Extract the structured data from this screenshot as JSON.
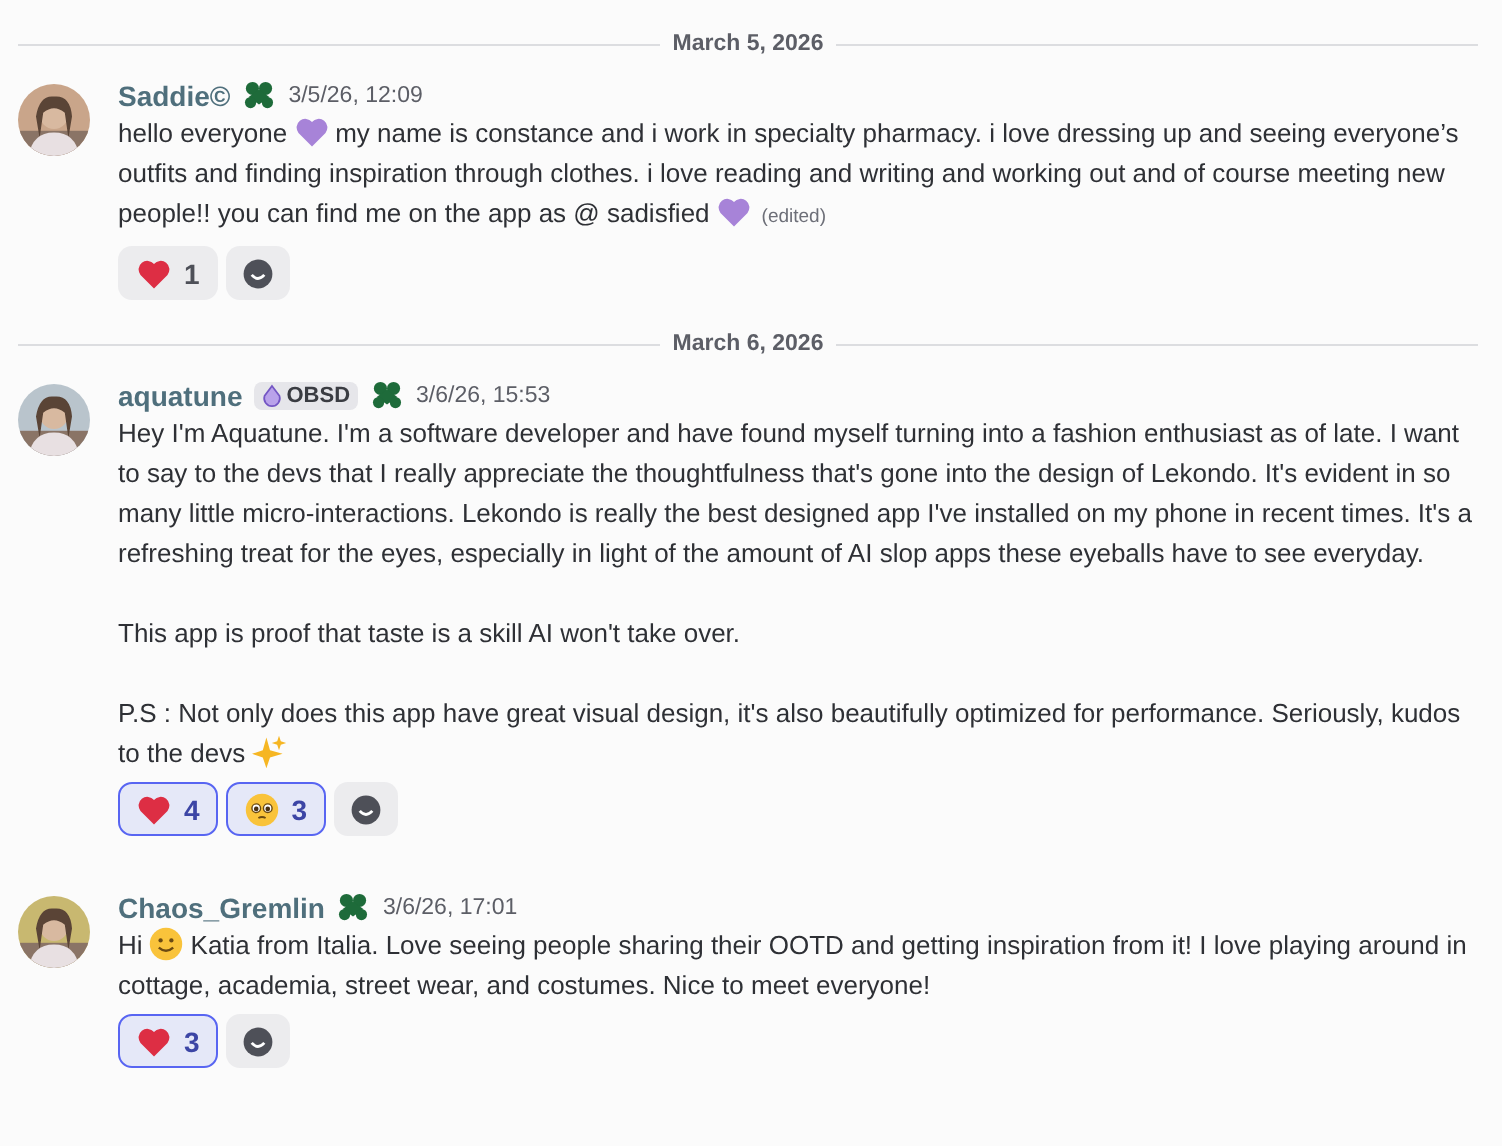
{
  "messages": [
    {
      "date_divider": "March 5, 2026",
      "author": "Saddie©",
      "avatar": {
        "kind": "picture"
      },
      "timestamp": "3/5/26, 12:09",
      "paragraphs": [
        [
          {
            "kind": "text",
            "text": "hello everyone"
          },
          {
            "kind": "heart"
          },
          {
            "kind": "text",
            "text": "my name is constance and i work in specialty pharmacy. i love dressing up and seeing everyone’s outfits and finding inspiration through clothes. i love reading and writing and working out and of course meeting new people!! you can find me on the app as @ sadisfied"
          },
          {
            "kind": "heart"
          },
          {
            "kind": "edited",
            "text": "(edited)"
          }
        ]
      ],
      "reactions": [
        {
          "kind": "heart",
          "count": "1",
          "selected": false
        }
      ]
    },
    {
      "date_divider": "March 6, 2026",
      "author": "aquatune",
      "avatar": {
        "kind": "picture"
      },
      "tag": "OBSD",
      "timestamp": "3/6/26, 15:53",
      "paragraphs": [
        [
          {
            "kind": "text",
            "text": "Hey I'm Aquatune. I'm a software developer and have found myself turning into a fashion enthusiast as of late. I want to say to the devs that I really appreciate the thoughtfulness that's gone into the design of Lekondo. It's evident in so many little micro-interactions. Lekondo is really the best designed app I've installed on my phone in recent times. It's a refreshing treat for the eyes, especially in light of the amount of AI slop apps these eyeballs have to see everyday."
          }
        ],
        [
          {
            "kind": "text",
            "text": "This app is proof that taste is a skill AI won't take over."
          }
        ],
        [
          {
            "kind": "text",
            "text": "P.S : Not only does this app have great visual design, it's also beautifully optimized for performance. Seriously, kudos to the devs"
          },
          {
            "kind": "sparkles"
          }
        ]
      ],
      "reactions": [
        {
          "kind": "heart",
          "count": "4",
          "selected": true
        },
        {
          "kind": "pleading",
          "count": "3",
          "selected": true
        }
      ]
    },
    {
      "author": "Chaos_Gremlin",
      "avatar": {
        "kind": "picture"
      },
      "timestamp": "3/6/26, 17:01",
      "paragraphs": [
        [
          {
            "kind": "text",
            "text": "Hi"
          },
          {
            "kind": "smile"
          },
          {
            "kind": "text",
            "text": "Katia from Italia. Love seeing people sharing their OOTD and getting inspiration from it! I love playing around in cottage, academia, street wear, and costumes. Nice to meet everyone!"
          }
        ]
      ],
      "reactions": [
        {
          "kind": "heart",
          "count": "3",
          "selected": true
        }
      ]
    }
  ]
}
